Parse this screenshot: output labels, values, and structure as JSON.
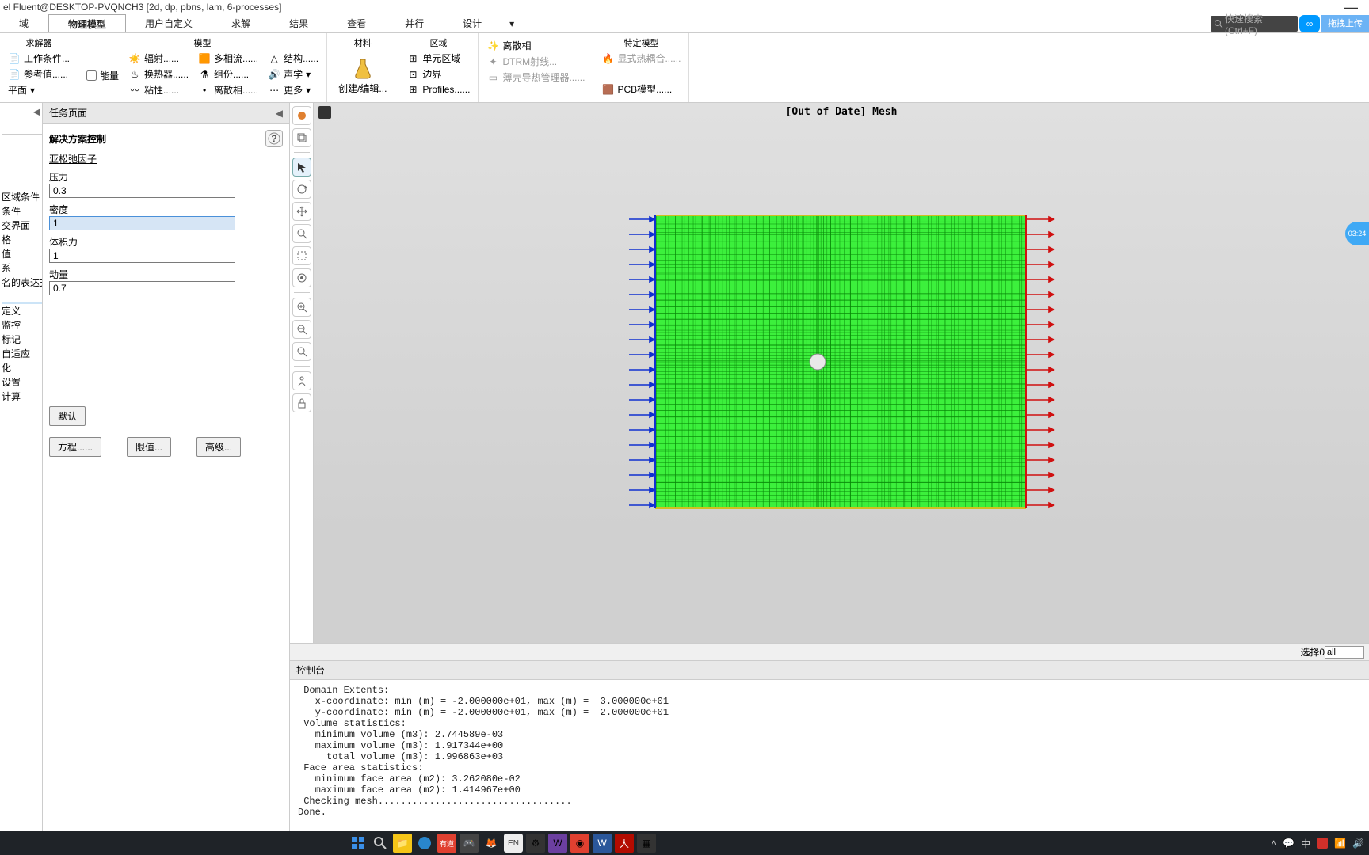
{
  "title": "el Fluent@DESKTOP-PVQNCH3 [2d, dp, pbns, lam, 6-processes]",
  "search_placeholder": "快速搜索 (Ctrl+F)",
  "cloud_icon": "∞",
  "drag_label": "拖拽上传",
  "tabs": {
    "t0": "域",
    "t1": "物理模型",
    "t2": "用户自定义",
    "t3": "求解",
    "t4": "结果",
    "t5": "查看",
    "t6": "并行",
    "t7": "设计",
    "more": "▾"
  },
  "ribbon": {
    "g1": {
      "title": "求解器",
      "items": {
        "a": "工作条件...",
        "b": "参考值......",
        "c": "平面"
      }
    },
    "g2": {
      "title": "模型",
      "energy": "能量",
      "rad": "辐射......",
      "multi": "多相流......",
      "struct": "结构......",
      "hx": "换热器......",
      "spec": "组份......",
      "acous": "声学",
      "visc": "粘性......",
      "disc": "离散相......",
      "more": "更多"
    },
    "g3": {
      "title": "材料",
      "item": "创建/编辑..."
    },
    "g4": {
      "title": "区域",
      "cell": "单元区域",
      "bound": "边界",
      "prof": "Profiles......"
    },
    "g5": {
      "title": "",
      "disc": "离散相",
      "dtrm": "DTRM射线...",
      "shell": "薄壳导热管理器......"
    },
    "g6": {
      "title": "特定模型",
      "szh": "显式热耦合......",
      "pcb": "PCB模型......"
    }
  },
  "tree": {
    "items": [
      "区域条件",
      "条件",
      "交界面",
      "格",
      "值",
      "系",
      "名的表达式",
      "",
      "定义",
      "监控",
      "标记",
      "自适应",
      "化",
      "设置",
      "计算"
    ]
  },
  "task": {
    "title": "任务页面",
    "heading": "解决方案控制",
    "subheading": "亚松弛因子",
    "f1_label": "压力",
    "f1_val": "0.3",
    "f2_label": "密度",
    "f2_val": "1",
    "f3_label": "体积力",
    "f3_val": "1",
    "f4_label": "动量",
    "f4_val": "0.7",
    "btn_default": "默认",
    "btn_eq": "方程......",
    "btn_lim": "限值...",
    "btn_adv": "高级..."
  },
  "gfx": {
    "header": "[Out of Date] Mesh",
    "select_label": "选择0",
    "select_val": "all"
  },
  "console": {
    "title": "控制台",
    "body": " Domain Extents:\n   x-coordinate: min (m) = -2.000000e+01, max (m) =  3.000000e+01\n   y-coordinate: min (m) = -2.000000e+01, max (m) =  2.000000e+01\n Volume statistics:\n   minimum volume (m3): 2.744589e-03\n   maximum volume (m3): 1.917344e+00\n     total volume (m3): 1.996863e+03\n Face area statistics:\n   minimum face area (m2): 3.262080e-02\n   maximum face area (m2): 1.414967e+00\n Checking mesh..................................\nDone."
  },
  "timer": "03:24",
  "tray": {
    "en": "EN",
    "zh": "中"
  }
}
